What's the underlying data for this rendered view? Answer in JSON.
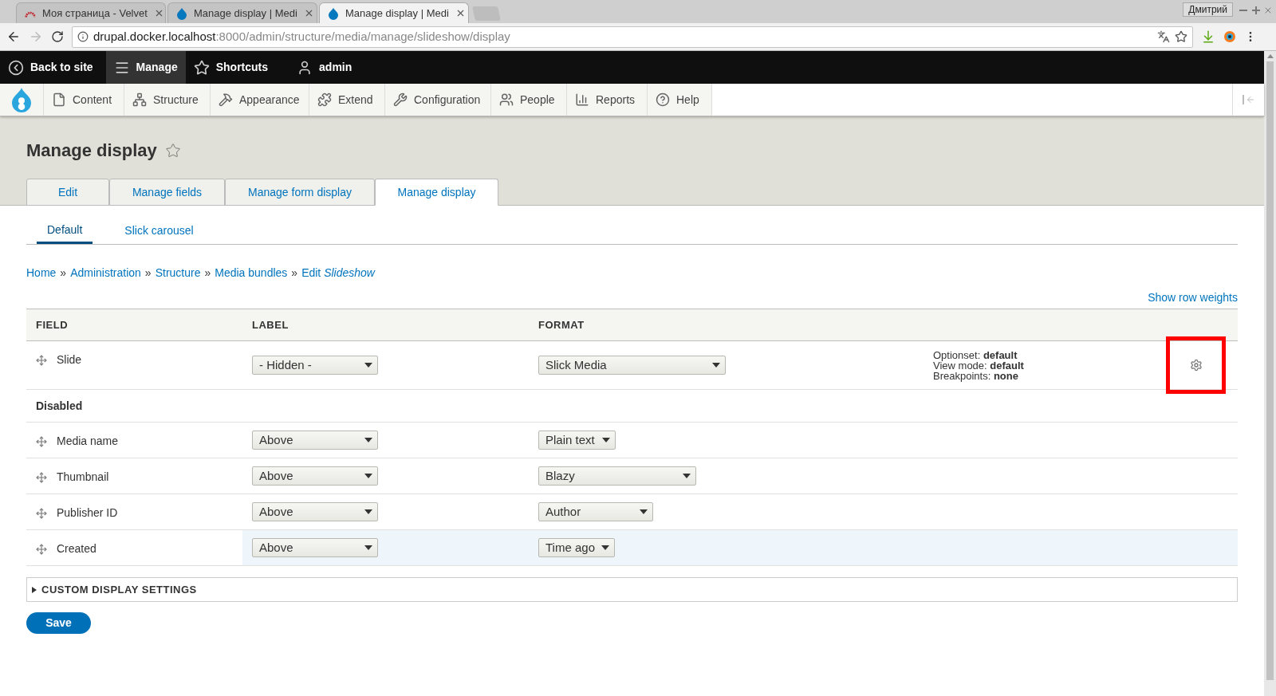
{
  "browser": {
    "tabs": [
      {
        "title": "Моя страница - Velvet",
        "kind": "velvet",
        "selected": false
      },
      {
        "title": "Manage display | Medi",
        "kind": "drupal",
        "selected": false
      },
      {
        "title": "Manage display | Medi",
        "kind": "drupal",
        "selected": true
      }
    ],
    "profile": "Дмитрий",
    "url_host": "drupal.docker.localhost",
    "url_path": ":8000/admin/structure/media/manage/slideshow/display"
  },
  "toolbar": {
    "items": [
      {
        "label": "Back to site",
        "kind": "back",
        "selected": false
      },
      {
        "label": "Manage",
        "kind": "menu",
        "selected": true
      },
      {
        "label": "Shortcuts",
        "kind": "star",
        "selected": false
      },
      {
        "label": "admin",
        "kind": "user",
        "selected": false
      }
    ]
  },
  "admin_menu": {
    "items": [
      {
        "label": "Content",
        "kind": "file"
      },
      {
        "label": "Structure",
        "kind": "tree"
      },
      {
        "label": "Appearance",
        "kind": "brush"
      },
      {
        "label": "Extend",
        "kind": "puzzle"
      },
      {
        "label": "Configuration",
        "kind": "wrench"
      },
      {
        "label": "People",
        "kind": "people"
      },
      {
        "label": "Reports",
        "kind": "chart"
      },
      {
        "label": "Help",
        "kind": "help"
      }
    ]
  },
  "page_title": "Manage display",
  "primary_tabs": [
    {
      "label": "Edit",
      "selected": false
    },
    {
      "label": "Manage fields",
      "selected": false
    },
    {
      "label": "Manage form display",
      "selected": false
    },
    {
      "label": "Manage display",
      "selected": true
    }
  ],
  "secondary_tabs": [
    {
      "label": "Default",
      "selected": true
    },
    {
      "label": "Slick carousel",
      "selected": false
    }
  ],
  "breadcrumb": [
    {
      "kind": "link",
      "text": "Home"
    },
    {
      "kind": "separator",
      "text": "»"
    },
    {
      "kind": "link",
      "text": "Administration"
    },
    {
      "kind": "separator",
      "text": "»"
    },
    {
      "kind": "link",
      "text": "Structure"
    },
    {
      "kind": "separator",
      "text": "»"
    },
    {
      "kind": "link",
      "text": "Media bundles"
    },
    {
      "kind": "separator",
      "text": "»"
    },
    {
      "kind": "link",
      "text": "Edit *Slideshow*"
    }
  ],
  "show_row_weights": "Show row weights",
  "table": {
    "columns": [
      "FIELD",
      "LABEL",
      "FORMAT"
    ],
    "rows": [
      {
        "kind": "field",
        "name": "Slide",
        "label": "- Hidden -",
        "format": "Slick Media",
        "summary": [
          "Optionset: **default**",
          "View mode: **default**",
          "Breakpoints: **none**"
        ],
        "settings": true,
        "annotated": true,
        "highlighted": false
      },
      {
        "kind": "region",
        "name": "Disabled"
      },
      {
        "kind": "field",
        "name": "Media name",
        "label": "Above",
        "format": "Plain text",
        "settings": false,
        "annotated": false,
        "highlighted": false
      },
      {
        "kind": "field",
        "name": "Thumbnail",
        "label": "Above",
        "format": "Blazy",
        "settings": false,
        "annotated": false,
        "highlighted": false
      },
      {
        "kind": "field",
        "name": "Publisher ID",
        "label": "Above",
        "format": "Author",
        "settings": false,
        "annotated": false,
        "highlighted": false
      },
      {
        "kind": "field",
        "name": "Created",
        "label": "Above",
        "format": "Time ago",
        "settings": false,
        "annotated": false,
        "highlighted": true
      }
    ]
  },
  "custom_settings": {
    "label": "CUSTOM DISPLAY SETTINGS",
    "expanded": false
  },
  "save": "Save"
}
